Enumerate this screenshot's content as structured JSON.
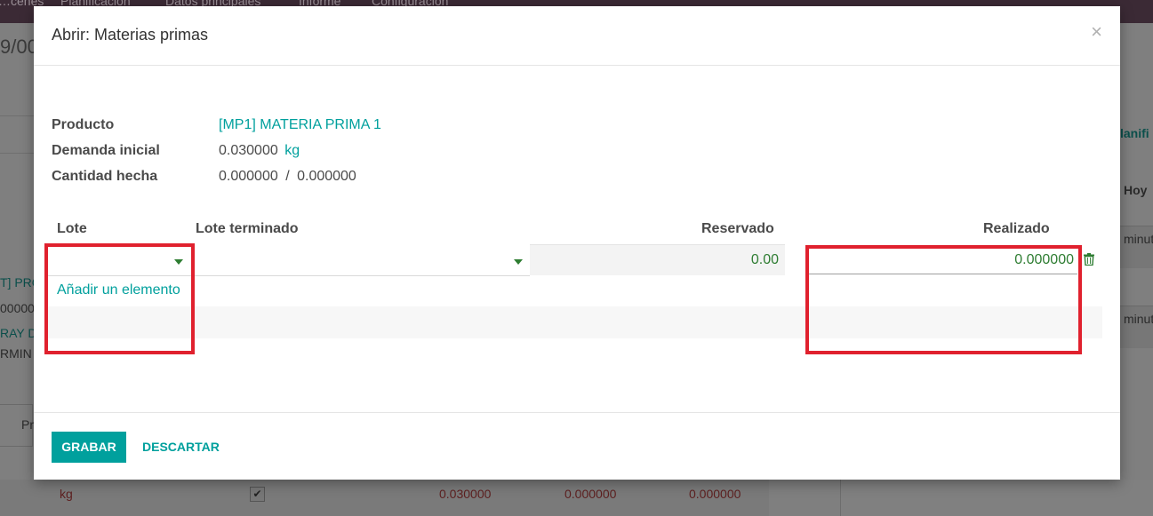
{
  "background": {
    "menu": [
      "…cenes",
      "Planificación",
      "Datos principales",
      "Informe",
      "Configuración"
    ],
    "record_title": "9/00",
    "left_fragments": [
      "T] PRO",
      "00000",
      "RAY D",
      "RMIN"
    ],
    "tab_fragment": "Pr",
    "right_fragments": [
      "lanifi",
      "Hoy",
      "minut",
      "minut"
    ],
    "bottom_row": {
      "uom": "kg",
      "checkbox": "✔",
      "values": [
        "0.030000",
        "0.000000",
        "0.000000"
      ]
    }
  },
  "modal": {
    "title": "Abrir: Materias primas",
    "close_symbol": "×",
    "fields": [
      {
        "label": "Producto",
        "value": "[MP1] MATERIA PRIMA 1"
      },
      {
        "label": "Demanda inicial",
        "value": "0.030000",
        "unit": "kg"
      },
      {
        "label": "Cantidad hecha",
        "value": "0.000000",
        "separator": "/",
        "total": "0.000000"
      }
    ],
    "table": {
      "headers": [
        "Lote",
        "Lote terminado",
        "Reservado",
        "Realizado"
      ],
      "row": {
        "lot": "",
        "finished_lot": "",
        "reserved": "0.00",
        "done": "0.000000"
      },
      "add_item": "Añadir un elemento"
    },
    "footer": {
      "save": "GRABAR",
      "discard": "DESCARTAR"
    }
  },
  "colors": {
    "accent": "#00a09d",
    "numeric_green": "#2e7d32",
    "highlight_red": "#e0212e"
  }
}
